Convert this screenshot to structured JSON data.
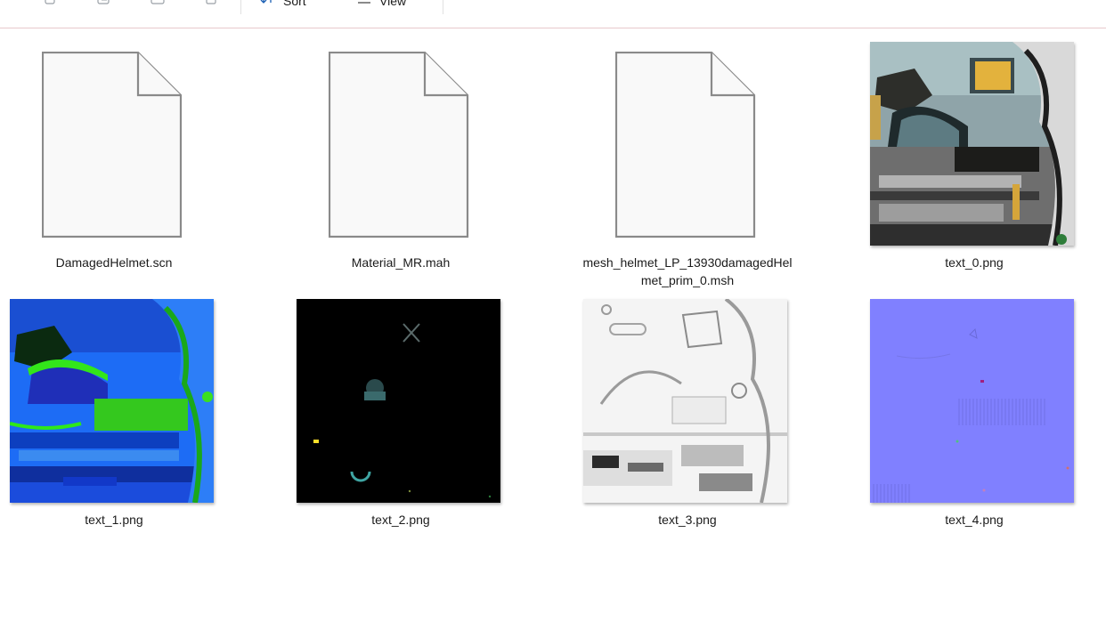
{
  "toolbar": {
    "sort_label": "Sort",
    "view_label": "View",
    "icons": [
      "copy-icon",
      "paste-icon",
      "share-icon",
      "delete-icon",
      "sort-icon",
      "view-icon"
    ]
  },
  "files": [
    {
      "name": "DamagedHelmet.scn",
      "kind": "generic-file-icon"
    },
    {
      "name": "Material_MR.mah",
      "kind": "generic-file-icon"
    },
    {
      "name": "mesh_helmet_LP_13930damagedHelmet_prim_0.msh",
      "kind": "generic-file-icon"
    },
    {
      "name": "text_0.png",
      "kind": "image-thumbnail"
    },
    {
      "name": "text_1.png",
      "kind": "image-thumbnail"
    },
    {
      "name": "text_2.png",
      "kind": "image-thumbnail"
    },
    {
      "name": "text_3.png",
      "kind": "image-thumbnail"
    },
    {
      "name": "text_4.png",
      "kind": "image-thumbnail"
    }
  ],
  "colors": {
    "toolbar_border": "#e8c9cc",
    "text": "#1b1b1b",
    "thumb_0_base": "#8fa4a9",
    "thumb_1_base": "#1d6cf5",
    "thumb_2_base": "#000000",
    "thumb_3_base": "#f4f4f4",
    "thumb_4_base": "#8080ff"
  }
}
